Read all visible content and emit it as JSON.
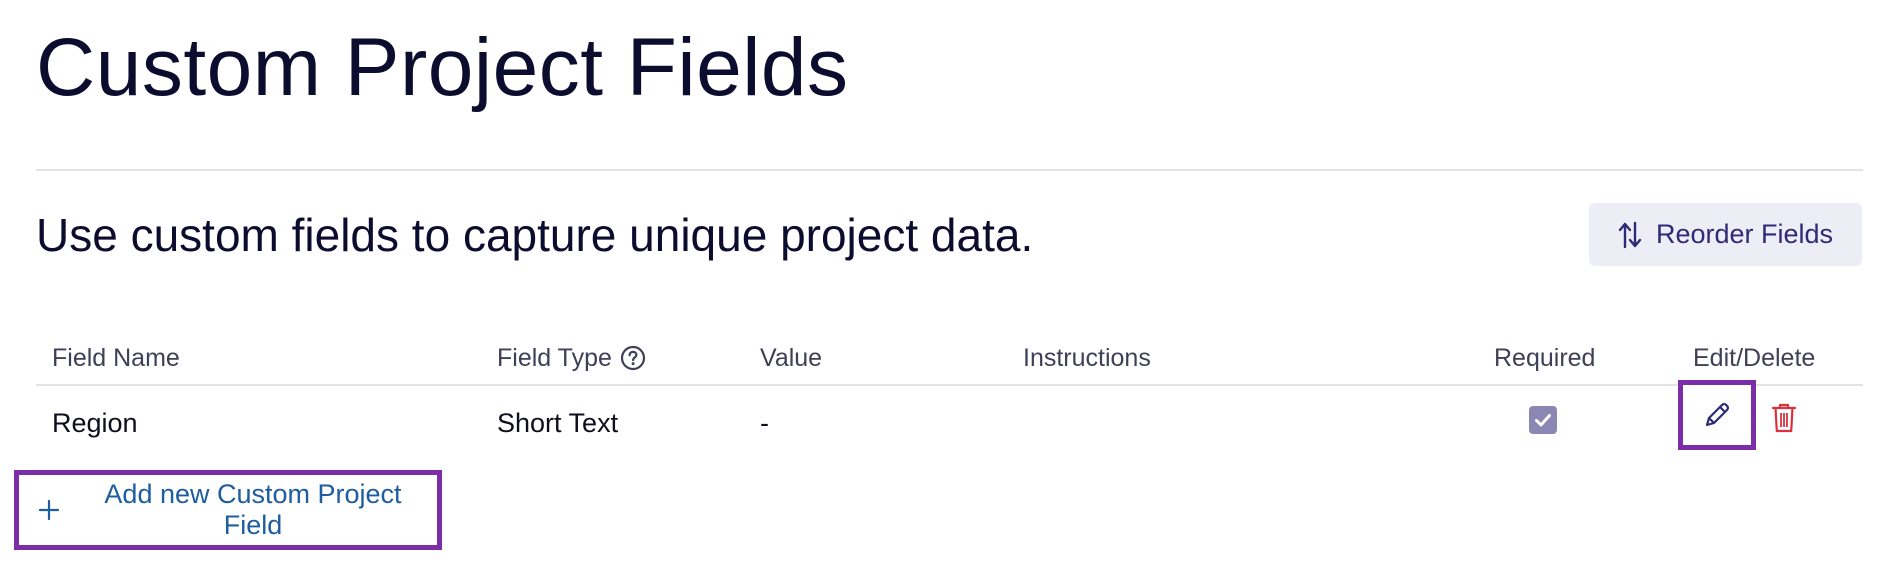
{
  "page": {
    "title": "Custom Project Fields",
    "subtitle": "Use custom fields to capture unique project data."
  },
  "toolbar": {
    "reorder_label": "Reorder Fields",
    "reorder_icon": "sort-arrows-icon"
  },
  "table": {
    "columns": {
      "field_name": "Field Name",
      "field_type": "Field Type",
      "value": "Value",
      "instructions": "Instructions",
      "required": "Required",
      "edit_delete": "Edit/Delete"
    },
    "rows": [
      {
        "field_name": "Region",
        "field_type": "Short Text",
        "value": "-",
        "instructions": "",
        "required": true
      }
    ]
  },
  "actions": {
    "add_label": "Add new Custom Project Field"
  },
  "colors": {
    "title_text": "#0c0c2e",
    "accent_purple": "#7b2ea8",
    "link_blue": "#1d5da0",
    "checkbox_fill": "#8b86b2",
    "delete_red": "#d9323f",
    "button_bg": "#ededf5"
  }
}
